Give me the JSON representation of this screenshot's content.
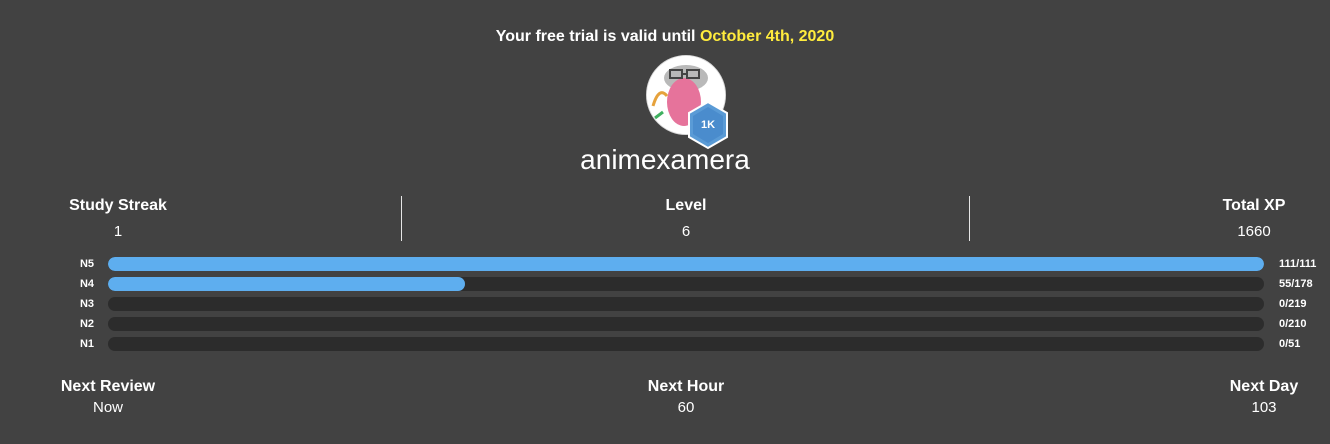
{
  "trial": {
    "prefix": "Your free trial is valid until",
    "date": "October 4th, 2020"
  },
  "profile": {
    "username": "animexamera",
    "badge": "1K"
  },
  "stats": {
    "study_streak": {
      "label": "Study Streak",
      "value": "1"
    },
    "level": {
      "label": "Level",
      "value": "6"
    },
    "total_xp": {
      "label": "Total XP",
      "value": "1660"
    }
  },
  "progress": [
    {
      "level": "N5",
      "count": "111/111",
      "fraction": 1.0
    },
    {
      "level": "N4",
      "count": "55/178",
      "fraction": 0.309
    },
    {
      "level": "N3",
      "count": "0/219",
      "fraction": 0
    },
    {
      "level": "N2",
      "count": "0/210",
      "fraction": 0
    },
    {
      "level": "N1",
      "count": "0/51",
      "fraction": 0
    }
  ],
  "reviews": {
    "next_review": {
      "label": "Next Review",
      "value": "Now"
    },
    "next_hour": {
      "label": "Next Hour",
      "value": "60"
    },
    "next_day": {
      "label": "Next Day",
      "value": "103"
    }
  },
  "colors": {
    "background": "#424242",
    "accent": "#5eaeef",
    "highlight": "#ffec3d",
    "track": "#2c2c2c"
  },
  "icons": {
    "badge": "hexagon-badge-icon",
    "avatar": "profile-avatar"
  }
}
